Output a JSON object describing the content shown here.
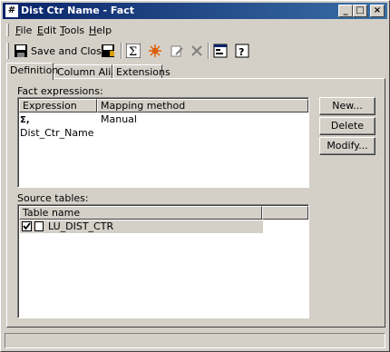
{
  "window": {
    "title": "Dist Ctr Name - Fact",
    "app_icon_glyph": "#"
  },
  "titlebar_buttons": {
    "minimize": "_",
    "maximize": "□",
    "close": "×"
  },
  "menu": [
    {
      "label": "File",
      "accel": "F"
    },
    {
      "label": "Edit",
      "accel": "E"
    },
    {
      "label": "Tools",
      "accel": "T"
    },
    {
      "label": "Help",
      "accel": "H"
    }
  ],
  "toolbar": {
    "save_and_close_label": "Save and Close"
  },
  "tabs": [
    {
      "label": "Definition"
    },
    {
      "label": "Column Alias"
    },
    {
      "label": "Extensions"
    }
  ],
  "fact_expressions": {
    "label": "Fact expressions:",
    "columns": [
      "Expression",
      "Mapping method"
    ],
    "rows": [
      {
        "expression": "Dist_Ctr_Name",
        "mapping": "Manual"
      }
    ]
  },
  "buttons": {
    "new": "New...",
    "delete": "Delete",
    "modify": "Modify..."
  },
  "source_tables": {
    "label": "Source tables:",
    "columns": [
      "Table name"
    ],
    "rows": [
      {
        "name": "LU_DIST_CTR",
        "checked": true
      }
    ]
  },
  "colors": {
    "title_start": "#0a246a",
    "title_end": "#3a6ea5",
    "face": "#d4d0c8",
    "selection": "#d4d0c8"
  }
}
